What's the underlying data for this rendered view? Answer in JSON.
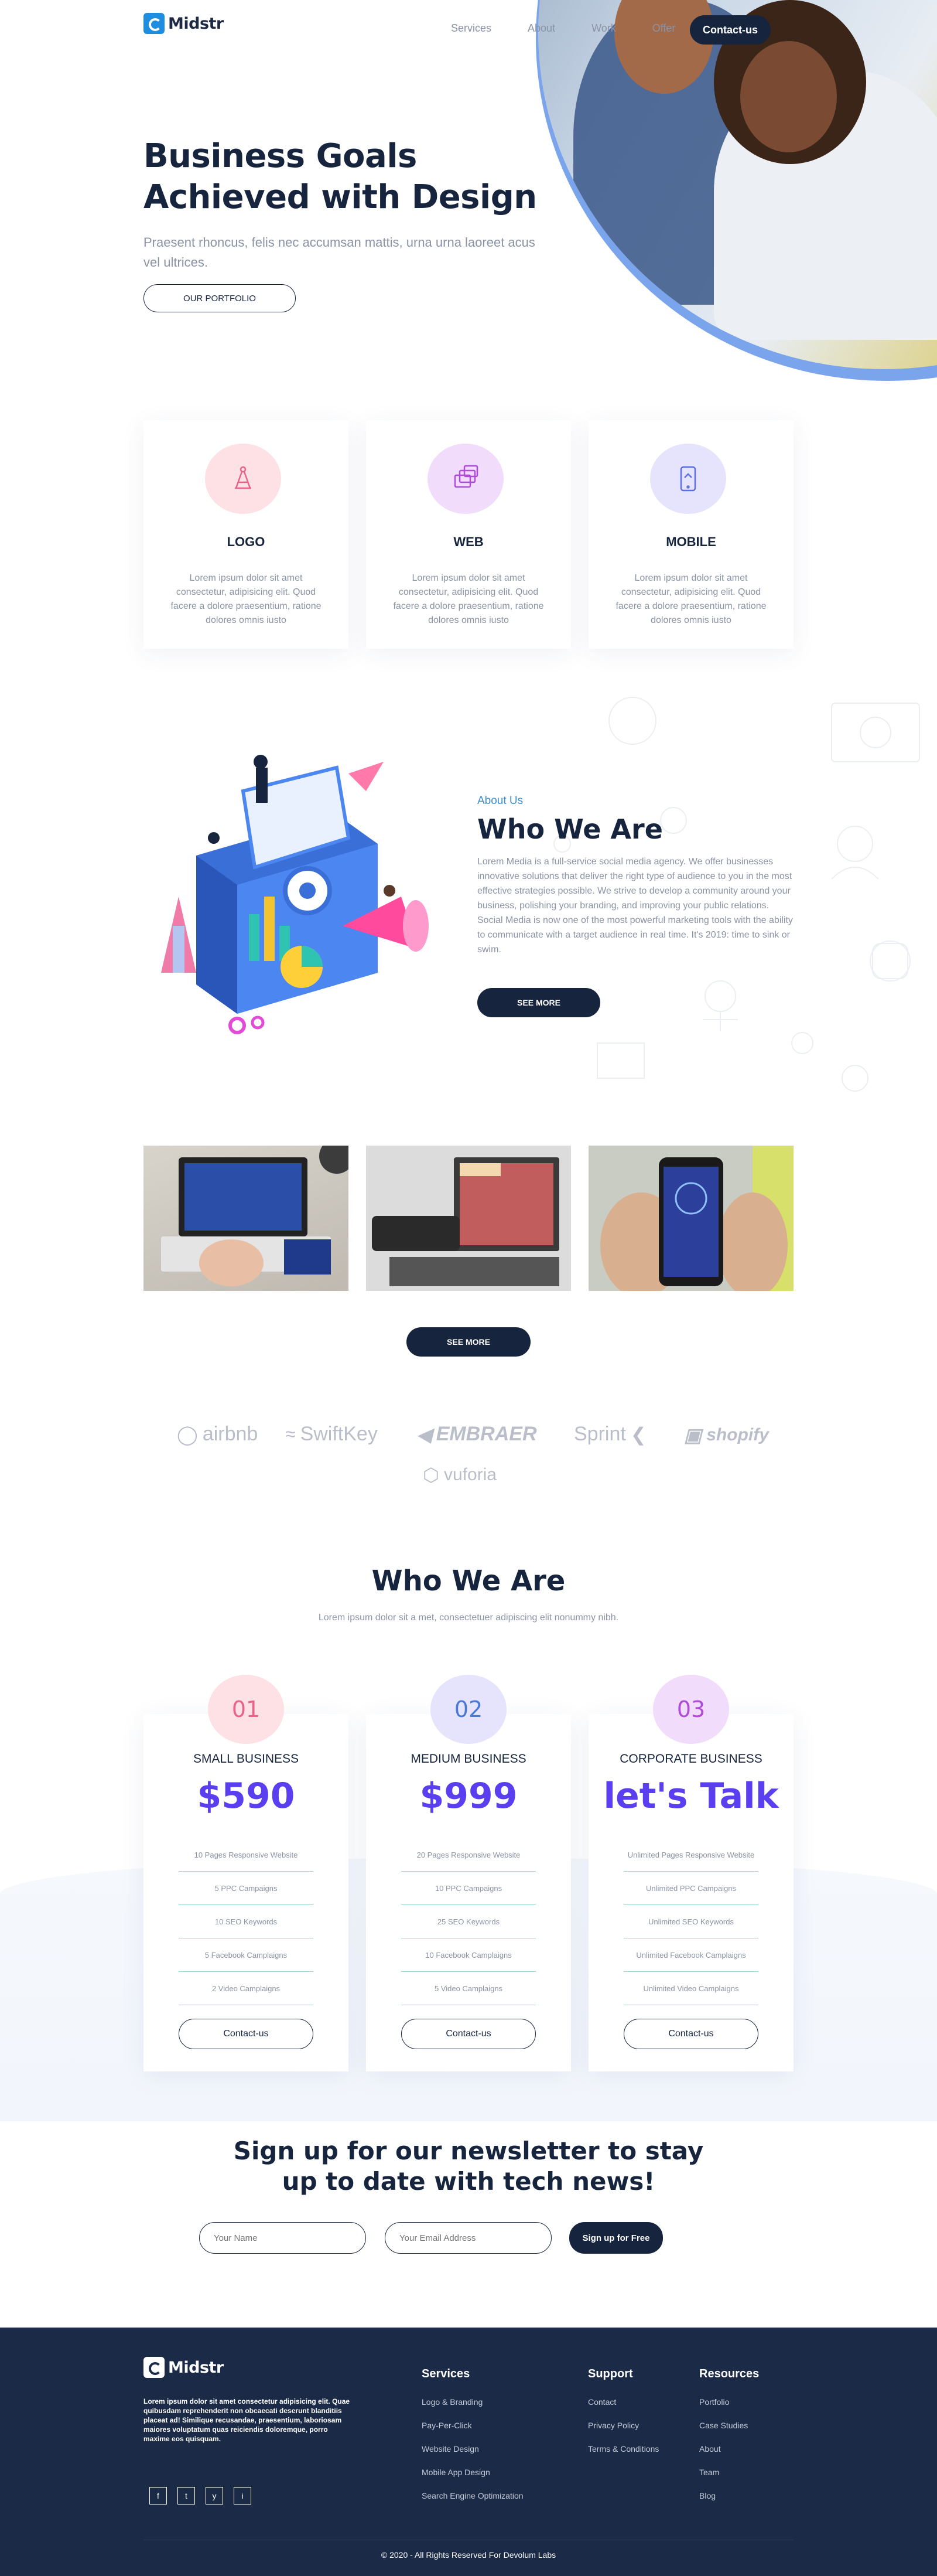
{
  "nav": {
    "brand": "Midstr",
    "links": [
      "Services",
      "About",
      "Work",
      "Offer"
    ],
    "cta": "Contact-us"
  },
  "hero": {
    "title": "Business Goals Achieved with Design",
    "subtitle": "Praesent rhoncus, felis nec accumsan mattis, urna urna laoreet acus vel ultrices.",
    "button": "OUR PORTFOLIO"
  },
  "services": [
    {
      "title": "LOGO",
      "text": "Lorem ipsum dolor sit amet consectetur, adipisicing elit. Quod facere a dolore praesentium, ratione dolores omnis iusto",
      "icon": "compass-icon",
      "color": "#fde1e4"
    },
    {
      "title": "WEB",
      "text": "Lorem ipsum dolor sit amet consectetur, adipisicing elit. Quod facere a dolore praesentium, ratione dolores omnis iusto",
      "icon": "web-stack-icon",
      "color": "#f2dcfb"
    },
    {
      "title": "MOBILE",
      "text": "Lorem ipsum dolor sit amet consectetur, adipisicing elit. Quod facere a dolore praesentium, ratione dolores omnis iusto",
      "icon": "mobile-icon",
      "color": "#e6e3fd"
    }
  ],
  "about": {
    "kicker": "About Us",
    "title": "Who We Are",
    "text": "Lorem Media is a full-service social media agency. We offer businesses innovative solutions that deliver the right type of audience to you in the most effective strategies possible. We strive to develop a community around your business, polishing your branding, and improving your public relations. Social Media is now one of the most powerful marketing tools with the ability to communicate with a target audience in real time. It's 2019: time to sink or swim.",
    "button": "SEE MORE"
  },
  "portfolio": {
    "button": "SEE MORE"
  },
  "brands": [
    "airbnb",
    "SwiftKey",
    "EMBRAER",
    "Sprint",
    "shopify",
    "vuforia"
  ],
  "pricing": {
    "title": "Who We Are",
    "subtitle": "Lorem ipsum dolor sit a met, consectetuer adipiscing elit nonummy nibh.",
    "plans": [
      {
        "num": "01",
        "name": "SMALL BUSINESS",
        "price": "$590",
        "num_color": "#e8628a",
        "num_bg": "#fde1e4",
        "features": [
          "10 Pages Responsive Website",
          "5 PPC Campaigns",
          "10 SEO Keywords",
          "5 Facebook Camplaigns",
          "2 Video Camplaigns"
        ],
        "button": "Contact-us"
      },
      {
        "num": "02",
        "name": "MEDIUM BUSINESS",
        "price": "$999",
        "num_color": "#4a7ad8",
        "num_bg": "#e6e3fd",
        "features": [
          "20 Pages Responsive Website",
          "10 PPC Campaigns",
          "25 SEO Keywords",
          "10 Facebook Camplaigns",
          "5 Video Camplaigns"
        ],
        "button": "Contact-us"
      },
      {
        "num": "03",
        "name": "CORPORATE BUSINESS",
        "price": "let's Talk",
        "num_color": "#b04ad8",
        "num_bg": "#f2dcfb",
        "features": [
          "Unlimited Pages Responsive Website",
          "Unlimited PPC Campaigns",
          "Unlimited SEO Keywords",
          "Unlimited Facebook Camplaigns",
          "Unlimited Video Camplaigns"
        ],
        "button": "Contact-us"
      }
    ]
  },
  "newsletter": {
    "title": "Sign up for our newsletter to stay up to date with tech news!",
    "name_placeholder": "Your Name",
    "email_placeholder": "Your Email Address",
    "button": "Sign up for Free"
  },
  "footer": {
    "brand": "Midstr",
    "about": "Lorem ipsum dolor sit amet consectetur adipisicing elit. Quae quibusdam reprehenderit non obcaecati deserunt blanditiis placeat ad! Similique recusandae, praesentium, laboriosam maiores voluptatum quas reiciendis doloremque, porro maxime eos quisquam.",
    "socials": [
      "f",
      "t",
      "y",
      "i"
    ],
    "columns": [
      {
        "title": "Services",
        "links": [
          "Logo & Branding",
          "Pay-Per-Click",
          "Website Design",
          "Mobile App Design",
          "Search Engine Optimization"
        ]
      },
      {
        "title": "Support",
        "links": [
          "Contact",
          "Privacy Policy",
          "Terms & Conditions"
        ]
      },
      {
        "title": "Resources",
        "links": [
          "Portfolio",
          "Case Studies",
          "About",
          "Team",
          "Blog"
        ]
      }
    ],
    "copyright": "© 2020 - All Rights Reserved For Devolum Labs"
  }
}
